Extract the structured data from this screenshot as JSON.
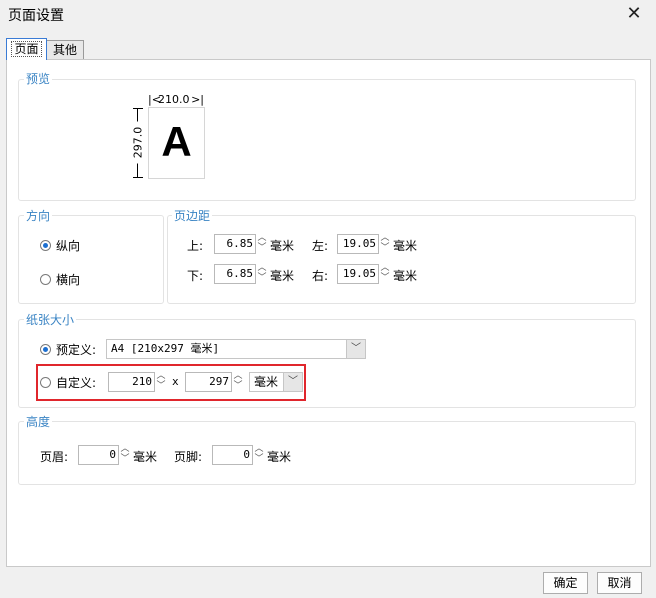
{
  "window": {
    "title": "页面设置"
  },
  "tabs": [
    {
      "label": "页面"
    },
    {
      "label": "其他"
    }
  ],
  "preview": {
    "group_label": "预览",
    "width_label": "210.0",
    "height_label": "297.0",
    "letter": "A"
  },
  "orientation": {
    "group_label": "方向",
    "portrait": "纵向",
    "landscape": "横向",
    "selected": "portrait"
  },
  "margins": {
    "group_label": "页边距",
    "top_label": "上:",
    "top_value": "6.85",
    "left_label": "左:",
    "left_value": "19.05",
    "bottom_label": "下:",
    "bottom_value": "6.85",
    "right_label": "右:",
    "right_value": "19.05",
    "unit": "毫米"
  },
  "paper": {
    "group_label": "纸张大小",
    "predefined_label": "预定义:",
    "predefined_value": "A4 [210x297 毫米]",
    "custom_label": "自定义:",
    "custom_width": "210",
    "times": "x",
    "custom_height": "297",
    "custom_unit": "毫米",
    "selected": "predefined"
  },
  "height": {
    "group_label": "高度",
    "header_label": "页眉:",
    "header_value": "0",
    "footer_label": "页脚:",
    "footer_value": "0",
    "unit": "毫米"
  },
  "buttons": {
    "ok": "确定",
    "cancel": "取消"
  },
  "colors": {
    "group_label": "#3a84c4",
    "highlight_box": "#e0262c",
    "radio_dot": "#1c6fd1"
  }
}
